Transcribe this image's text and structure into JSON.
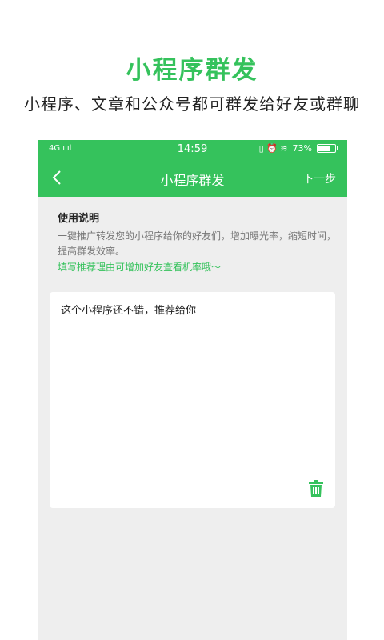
{
  "promo": {
    "title": "小程序群发",
    "subtitle": "小程序、文章和公众号都可群发给好友或群聊"
  },
  "status_bar": {
    "signal": "4G ıııl",
    "time": "14:59",
    "icons": "▯ ⏰ ≋",
    "battery": "73%"
  },
  "nav": {
    "back_icon": "chevron-left-icon",
    "title": "小程序群发",
    "next_label": "下一步"
  },
  "instructions": {
    "title": "使用说明",
    "body": "一键推广转发您的小程序给你的好友们，增加曝光率，缩短时间，提高群发效率。",
    "tip": "填写推荐理由可增加好友查看机率哦～"
  },
  "message": {
    "text": "这个小程序还不错，推荐给你",
    "delete_icon": "trash-icon"
  },
  "colors": {
    "brand": "#35c25c",
    "page_bg": "#eeeeee"
  }
}
